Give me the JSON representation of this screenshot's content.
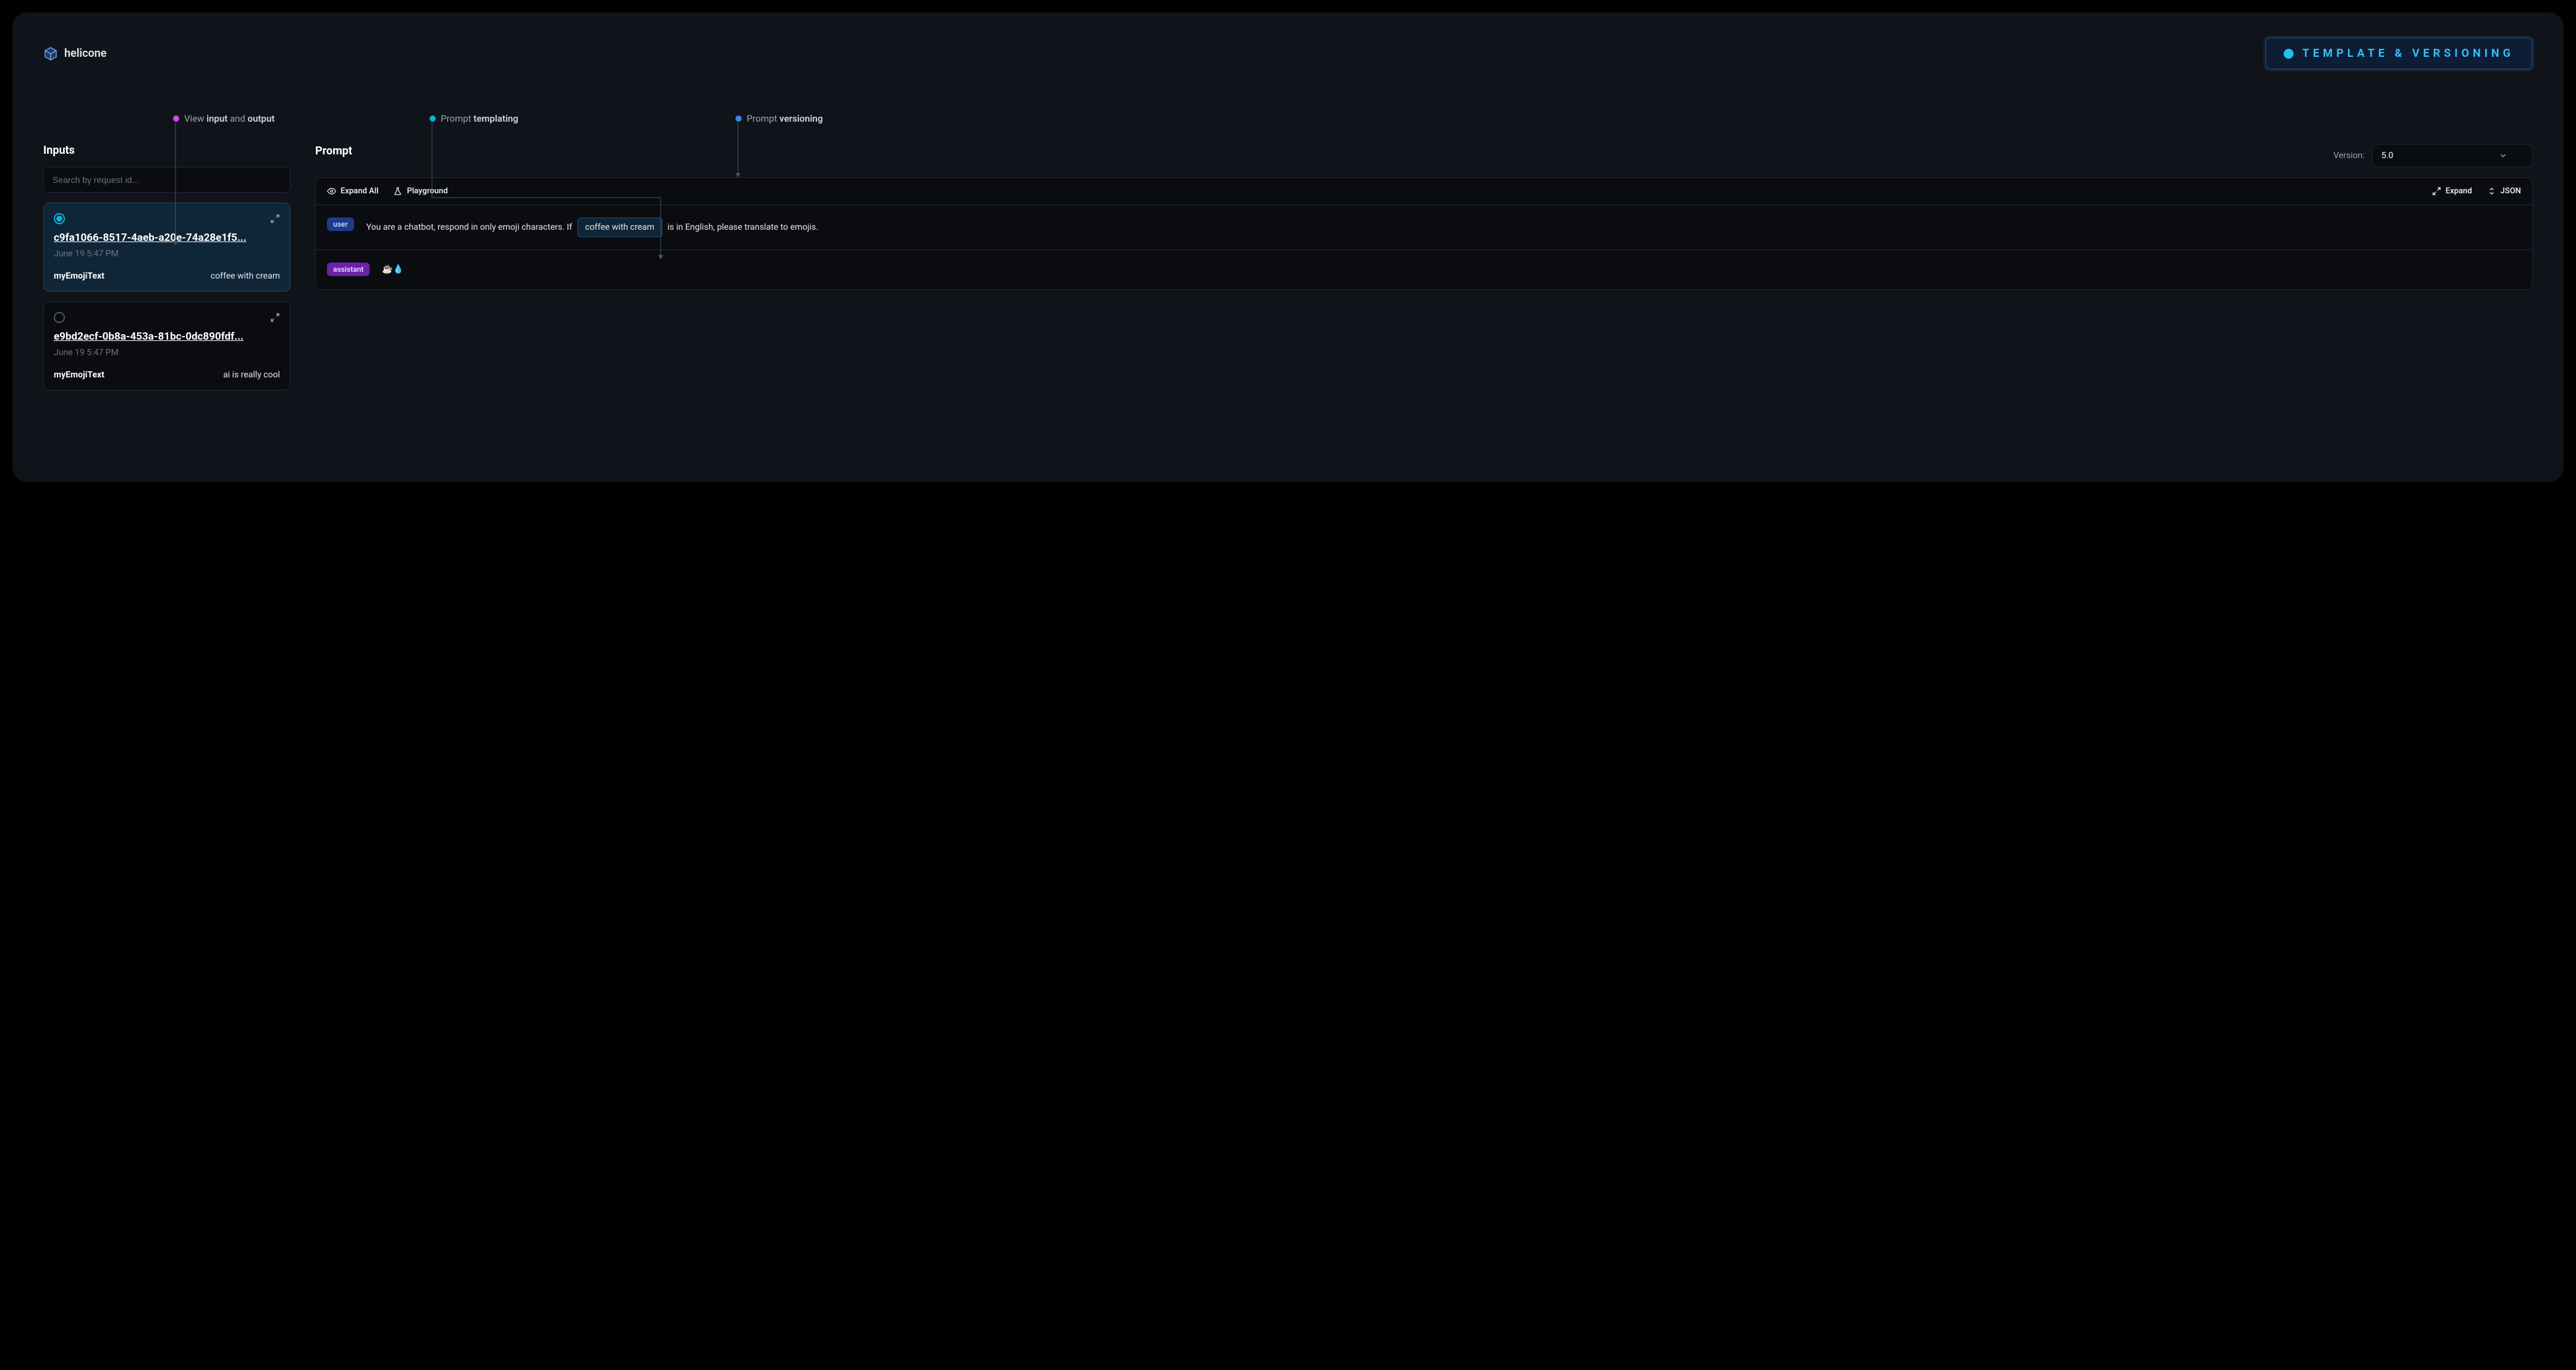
{
  "brand": "helicone",
  "badge": "TEMPLATE & VERSIONING",
  "annotations": {
    "a1_prefix": "View ",
    "a1_b1": "input",
    "a1_mid": " and ",
    "a1_b2": "output",
    "a2_prefix": "Prompt ",
    "a2_b1": "templating",
    "a3_prefix": "Prompt ",
    "a3_b1": "versioning"
  },
  "inputs": {
    "title": "Inputs",
    "searchPlaceholder": "Search by request id...",
    "cards": [
      {
        "id": "c9fa1066-8517-4aeb-a20e-74a28e1f5...",
        "date": "June 19 5:47 PM",
        "key": "myEmojiText",
        "value": "coffee with cream"
      },
      {
        "id": "e9bd2ecf-0b8a-453a-81bc-0dc890fdf...",
        "date": "June 19 5:47 PM",
        "key": "myEmojiText",
        "value": "ai is really cool"
      }
    ]
  },
  "prompt": {
    "title": "Prompt",
    "versionLabel": "Version:",
    "versionValue": "5.0",
    "toolbar": {
      "expandAll": "Expand All",
      "playground": "Playground",
      "expand": "Expand",
      "json": "JSON"
    },
    "messages": {
      "userRole": "user",
      "userPrefix": "You are a chatbot, respond in only emoji characters. If",
      "userVar": "coffee with cream",
      "userSuffix": "is in English, please translate to emojis.",
      "assistantRole": "assistant",
      "assistantContent": "☕💧"
    }
  }
}
